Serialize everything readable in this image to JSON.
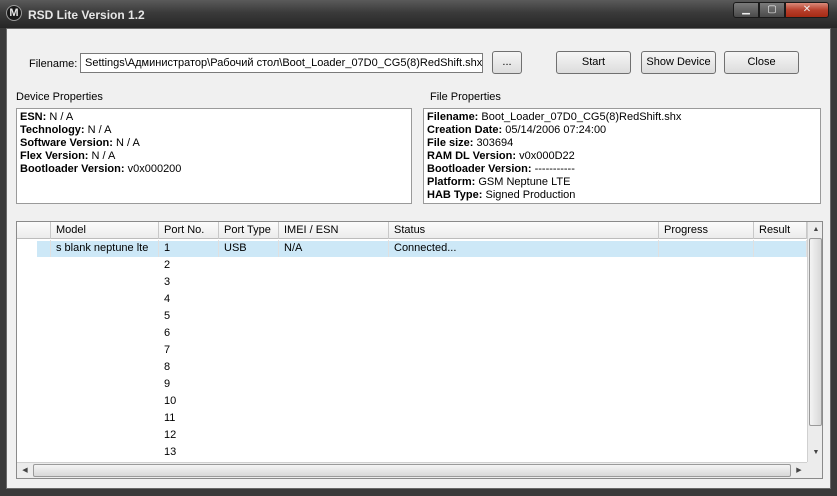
{
  "window": {
    "title": "RSD Lite Version 1.2",
    "icon": "motorola-logo-icon"
  },
  "toolbar": {
    "filename_label": "Filename:",
    "filename_value": "Settings\\Администратор\\Рабочий стол\\Boot_Loader_07D0_CG5(8)RedShift.shx",
    "browse_label": "...",
    "start_label": "Start",
    "show_device_label": "Show Device",
    "close_label": "Close"
  },
  "device_properties": {
    "title": "Device Properties",
    "items": [
      {
        "key": "ESN:",
        "value": "N / A"
      },
      {
        "key": "Technology:",
        "value": "N / A"
      },
      {
        "key": "Software Version:",
        "value": "N / A"
      },
      {
        "key": "Flex Version:",
        "value": "N / A"
      },
      {
        "key": "Bootloader Version:",
        "value": "v0x000200"
      }
    ]
  },
  "file_properties": {
    "title": "File Properties",
    "items": [
      {
        "key": "Filename:",
        "value": "Boot_Loader_07D0_CG5(8)RedShift.shx"
      },
      {
        "key": "Creation Date:",
        "value": "05/14/2006 07:24:00"
      },
      {
        "key": "File size:",
        "value": "303694"
      },
      {
        "key": "RAM DL Version:",
        "value": "v0x000D22"
      },
      {
        "key": "Bootloader Version:",
        "value": "-----------"
      },
      {
        "key": "Platform:",
        "value": "GSM Neptune LTE"
      },
      {
        "key": "HAB Type:",
        "value": "Signed Production"
      }
    ]
  },
  "device_table": {
    "columns": [
      "",
      "Model",
      "Port No.",
      "Port Type",
      "IMEI / ESN",
      "Status",
      "Progress",
      "Result"
    ],
    "rows": [
      [
        "",
        "s blank neptune lte",
        "1",
        "USB",
        "N/A",
        "Connected...",
        "",
        ""
      ],
      [
        "",
        "",
        "2",
        "",
        "",
        "",
        "",
        ""
      ],
      [
        "",
        "",
        "3",
        "",
        "",
        "",
        "",
        ""
      ],
      [
        "",
        "",
        "4",
        "",
        "",
        "",
        "",
        ""
      ],
      [
        "",
        "",
        "5",
        "",
        "",
        "",
        "",
        ""
      ],
      [
        "",
        "",
        "6",
        "",
        "",
        "",
        "",
        ""
      ],
      [
        "",
        "",
        "7",
        "",
        "",
        "",
        "",
        ""
      ],
      [
        "",
        "",
        "8",
        "",
        "",
        "",
        "",
        ""
      ],
      [
        "",
        "",
        "9",
        "",
        "",
        "",
        "",
        ""
      ],
      [
        "",
        "",
        "10",
        "",
        "",
        "",
        "",
        ""
      ],
      [
        "",
        "",
        "11",
        "",
        "",
        "",
        "",
        ""
      ],
      [
        "",
        "",
        "12",
        "",
        "",
        "",
        "",
        ""
      ],
      [
        "",
        "",
        "13",
        "",
        "",
        "",
        "",
        ""
      ]
    ],
    "selected_row": 0
  },
  "colors": {
    "selection": "#cde8f7",
    "titlebar": "#3a3a3a",
    "close_button": "#b8402c"
  }
}
